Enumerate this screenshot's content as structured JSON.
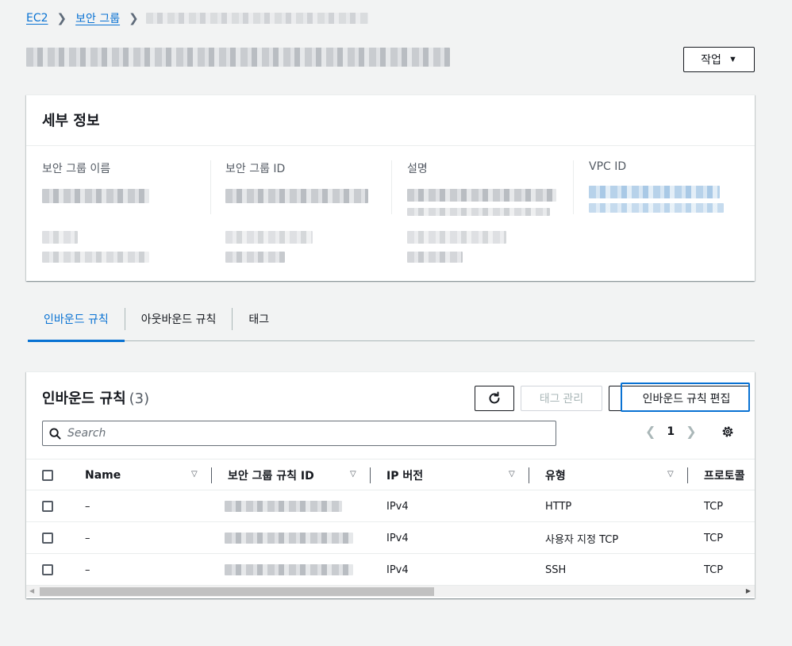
{
  "breadcrumb": {
    "ec2": "EC2",
    "security_groups": "보안 그룹"
  },
  "header": {
    "actions_label": "작업"
  },
  "details": {
    "title": "세부 정보",
    "labels": {
      "sg_name": "보안 그룹 이름",
      "sg_id": "보안 그룹 ID",
      "description": "설명",
      "vpc_id": "VPC ID"
    }
  },
  "tabs": [
    {
      "label": "인바운드 규칙",
      "active": true
    },
    {
      "label": "아웃바운드 규칙",
      "active": false
    },
    {
      "label": "태그",
      "active": false
    }
  ],
  "rules": {
    "title": "인바운드 규칙",
    "count": "(3)",
    "manage_tags_label": "태그 관리",
    "edit_rules_label": "인바운드 규칙 편집",
    "search_placeholder": "Search",
    "page": "1",
    "columns": {
      "name": "Name",
      "rule_id": "보안 그룹 규칙 ID",
      "ip_version": "IP 버전",
      "type": "유형",
      "protocol": "프로토콜"
    },
    "rows": [
      {
        "name": "–",
        "ip_version": "IPv4",
        "type": "HTTP",
        "protocol": "TCP"
      },
      {
        "name": "–",
        "ip_version": "IPv4",
        "type": "사용자 지정 TCP",
        "protocol": "TCP"
      },
      {
        "name": "–",
        "ip_version": "IPv4",
        "type": "SSH",
        "protocol": "TCP"
      }
    ]
  },
  "colors": {
    "accent": "#0972d3",
    "text": "#16191f",
    "muted": "#545b64",
    "background": "#f2f3f3"
  }
}
